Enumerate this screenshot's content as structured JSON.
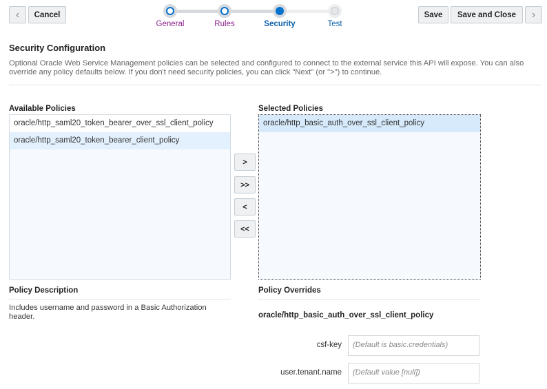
{
  "toolbar": {
    "cancel_label": "Cancel",
    "save_label": "Save",
    "save_close_label": "Save and Close",
    "back_icon": "‹",
    "next_icon": "›"
  },
  "train": {
    "steps": [
      {
        "label": "General",
        "state": "visited"
      },
      {
        "label": "Rules",
        "state": "visited"
      },
      {
        "label": "Security",
        "state": "current"
      },
      {
        "label": "Test",
        "state": "unvisited"
      }
    ]
  },
  "page": {
    "title": "Security Configuration",
    "description_line1": "Optional Oracle Web Service Management policies can be selected and configured to connect to the external service this API will expose. You can also",
    "description_line2": "override any policy defaults below. If you don't need security policies, you can click \"Next\" (or \">\") to continue."
  },
  "available": {
    "label": "Available Policies",
    "items": [
      "oracle/http_saml20_token_bearer_over_ssl_client_policy",
      "oracle/http_saml20_token_bearer_client_policy"
    ]
  },
  "selected": {
    "label": "Selected Policies",
    "items": [
      "oracle/http_basic_auth_over_ssl_client_policy"
    ]
  },
  "shuttle": {
    "move": ">",
    "move_all": ">>",
    "remove": "<",
    "remove_all": "<<"
  },
  "description": {
    "label": "Policy Description",
    "text_line1": "Includes username and password in a Basic Authorization",
    "text_line2": "header."
  },
  "overrides": {
    "label": "Policy Overrides",
    "policy_name": "oracle/http_basic_auth_over_ssl_client_policy",
    "fields": [
      {
        "label": "csf-key",
        "value": "",
        "placeholder": "(Default is basic.credentials)"
      },
      {
        "label": "user.tenant.name",
        "value": "",
        "placeholder": "(Default value [null])"
      }
    ]
  },
  "colors": {
    "visited": "#8a1d8c",
    "current": "#0a5fa8",
    "accent": "#0572ce"
  }
}
